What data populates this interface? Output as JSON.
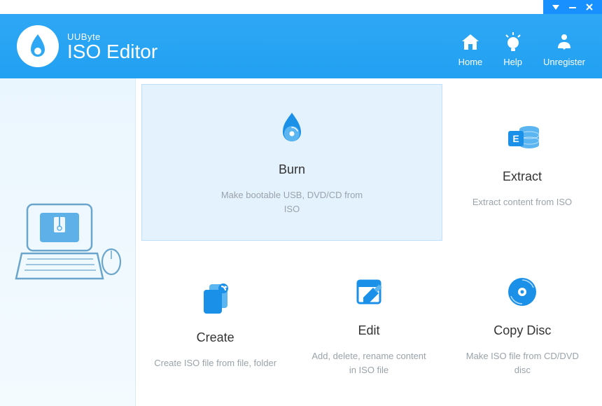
{
  "brand": "UUByte",
  "app_name": "ISO Editor",
  "colors": {
    "primary": "#1890ff",
    "header": "#22a0f2",
    "accent": "#1b90e8"
  },
  "window_controls": {
    "menu": "menu",
    "minimize": "minimize",
    "close": "close"
  },
  "nav": {
    "home": {
      "label": "Home",
      "icon": "home-icon"
    },
    "help": {
      "label": "Help",
      "icon": "lightbulb-icon"
    },
    "unregister": {
      "label": "Unregister",
      "icon": "person-down-icon"
    }
  },
  "sidebar_illustration": "laptop-with-zip-and-mouse",
  "cards": {
    "burn": {
      "title": "Burn",
      "desc": "Make bootable USB, DVD/CD from ISO",
      "icon": "burn-disc-icon",
      "active": true
    },
    "extract": {
      "title": "Extract",
      "desc": "Extract content from ISO",
      "icon": "extract-icon",
      "active": false
    },
    "create": {
      "title": "Create",
      "desc": "Create ISO file from file, folder",
      "icon": "create-doc-icon",
      "active": false
    },
    "edit": {
      "title": "Edit",
      "desc": "Add, delete, rename content in ISO file",
      "icon": "edit-icon",
      "active": false
    },
    "copydisc": {
      "title": "Copy Disc",
      "desc": "Make ISO file from CD/DVD disc",
      "icon": "copy-disc-icon",
      "active": false
    }
  }
}
